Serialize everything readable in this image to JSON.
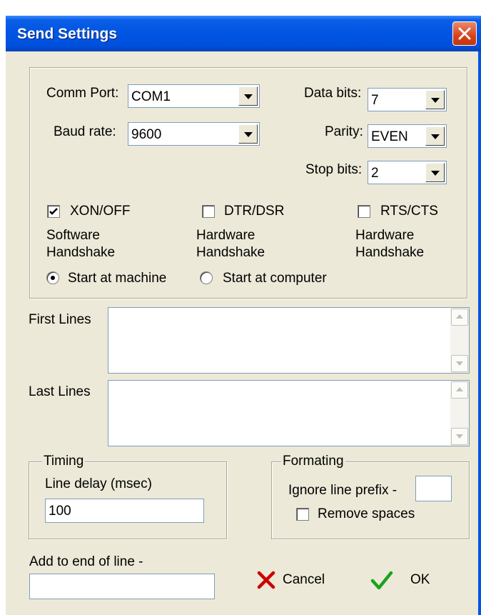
{
  "window": {
    "title": "Send Settings"
  },
  "comm": {
    "port_label": "Comm Port:",
    "port_value": "COM1",
    "baud_label": "Baud rate:",
    "baud_value": "9600",
    "data_bits_label": "Data bits:",
    "data_bits_value": "7",
    "parity_label": "Parity:",
    "parity_value": "EVEN",
    "stop_bits_label": "Stop bits:",
    "stop_bits_value": "2"
  },
  "handshake": {
    "xon": {
      "label": "XON/OFF",
      "checked": true,
      "desc1": "Software",
      "desc2": "Handshake"
    },
    "dtr": {
      "label": "DTR/DSR",
      "checked": false,
      "desc1": "Hardware",
      "desc2": "Handshake"
    },
    "rts": {
      "label": "RTS/CTS",
      "checked": false,
      "desc1": "Hardware",
      "desc2": "Handshake"
    }
  },
  "start": {
    "machine_label": "Start at machine",
    "machine_selected": true,
    "computer_label": "Start at computer",
    "computer_selected": false
  },
  "first_lines": {
    "label": "First Lines",
    "value": ""
  },
  "last_lines": {
    "label": "Last Lines",
    "value": ""
  },
  "timing": {
    "legend": "Timing",
    "line_delay_label": "Line delay (msec)",
    "line_delay_value": "100"
  },
  "formating": {
    "legend": "Formating",
    "ignore_prefix_label": "Ignore line prefix -",
    "ignore_prefix_value": "",
    "remove_spaces_label": "Remove spaces",
    "remove_spaces_checked": false
  },
  "end_of_line": {
    "label": "Add to end of line -",
    "value": ""
  },
  "buttons": {
    "cancel": "Cancel",
    "ok": "OK"
  },
  "icons": {
    "close": "close-icon",
    "cancel": "red-x-icon",
    "ok": "green-check-icon",
    "checkmark": "checkmark-icon"
  },
  "colors": {
    "titlebar": "#0054e3",
    "dialog_bg": "#ece9d8",
    "close": "#d9411b",
    "cancel_icon": "#cc0000",
    "ok_icon": "#1aa31a"
  }
}
